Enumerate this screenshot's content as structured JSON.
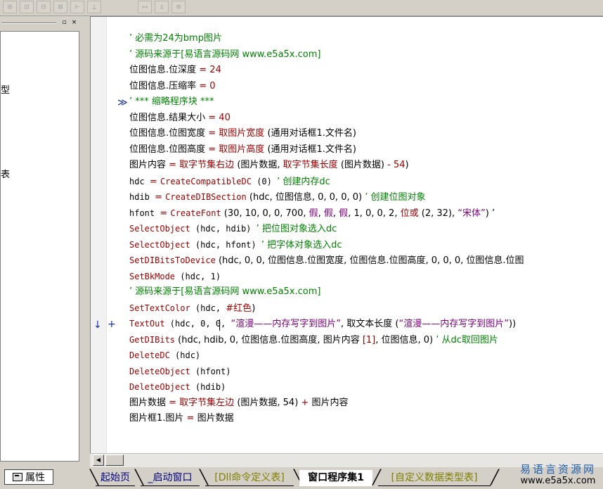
{
  "toolbar": {
    "buttons": [
      {
        "icon": "align-center-icon",
        "glyph": "⊞"
      },
      {
        "icon": "align-top-icon",
        "glyph": "⊡"
      },
      {
        "icon": "align-middle-icon",
        "glyph": "⊟"
      },
      {
        "icon": "align-bottom-icon",
        "glyph": "⊠"
      },
      {
        "icon": "same-width-icon",
        "glyph": "⊢"
      },
      {
        "icon": "same-height-icon",
        "glyph": "⊥"
      },
      {
        "icon": "h-spacing-icon",
        "glyph": "⟷"
      },
      {
        "icon": "v-spacing-icon",
        "glyph": "↕"
      },
      {
        "icon": "center-form-icon",
        "glyph": "⊕"
      }
    ]
  },
  "left_panel": {
    "close_glyph": "×",
    "restore_glyph": "▫",
    "fragments": [
      "型",
      "表"
    ]
  },
  "code": {
    "lines": [
      {
        "indent": 1,
        "parts": [
          {
            "t": "’ 必需为24为bmp图片",
            "c": "c-comment"
          }
        ]
      },
      {
        "indent": 1,
        "parts": [
          {
            "t": "’ 源码来源于[易语言源码网 www.e5a5x.com]",
            "c": "c-comment"
          }
        ]
      },
      {
        "indent": 1,
        "parts": [
          {
            "t": "位图信息.位深度 ",
            "c": "c-black"
          },
          {
            "t": "= ",
            "c": "c-red"
          },
          {
            "t": "24",
            "c": "c-num"
          }
        ]
      },
      {
        "indent": 1,
        "parts": [
          {
            "t": "位图信息.压缩率 ",
            "c": "c-black"
          },
          {
            "t": "= ",
            "c": "c-red"
          },
          {
            "t": "0",
            "c": "c-num"
          }
        ]
      },
      {
        "indent": 1,
        "parts": [
          {
            "t": "’ *** 缩略程序块 ***",
            "c": "c-comment"
          }
        ]
      },
      {
        "indent": 1,
        "parts": [
          {
            "t": "位图信息.结果大小 ",
            "c": "c-black"
          },
          {
            "t": "= ",
            "c": "c-red"
          },
          {
            "t": "40",
            "c": "c-num"
          }
        ]
      },
      {
        "indent": 1,
        "parts": [
          {
            "t": "位图信息.位图宽度 ",
            "c": "c-black"
          },
          {
            "t": "= ",
            "c": "c-red"
          },
          {
            "t": "取图片宽度",
            "c": "c-red"
          },
          {
            "t": " (通用对话框1.文件名)",
            "c": "c-black"
          }
        ]
      },
      {
        "indent": 1,
        "parts": [
          {
            "t": "位图信息.位图高度 ",
            "c": "c-black"
          },
          {
            "t": "= ",
            "c": "c-red"
          },
          {
            "t": "取图片高度",
            "c": "c-red"
          },
          {
            "t": " (通用对话框1.文件名)",
            "c": "c-black"
          }
        ]
      },
      {
        "indent": 1,
        "parts": [
          {
            "t": "图片内容 ",
            "c": "c-black"
          },
          {
            "t": "= ",
            "c": "c-red"
          },
          {
            "t": "取字节集右边",
            "c": "c-red"
          },
          {
            "t": " (图片数据, ",
            "c": "c-black"
          },
          {
            "t": "取字节集长度",
            "c": "c-red"
          },
          {
            "t": " (图片数据) ",
            "c": "c-black"
          },
          {
            "t": "- 54",
            "c": "c-red"
          },
          {
            "t": ")",
            "c": "c-black"
          }
        ]
      },
      {
        "indent": 1,
        "parts": [
          {
            "t": "hdc ",
            "c": "c-black mono"
          },
          {
            "t": "= ",
            "c": "c-red"
          },
          {
            "t": "CreateCompatibleDC",
            "c": "c-red mono"
          },
          {
            "t": " (0) ",
            "c": "c-black mono"
          },
          {
            "t": "’ 创建内存dc",
            "c": "c-comment"
          }
        ]
      },
      {
        "indent": 1,
        "parts": [
          {
            "t": "hdib ",
            "c": "c-black mono"
          },
          {
            "t": "= ",
            "c": "c-red"
          },
          {
            "t": "CreateDIBSection",
            "c": "c-red mono"
          },
          {
            "t": " (hdc, 位图信息, 0, 0, 0, 0) ",
            "c": "c-black"
          },
          {
            "t": "’ 创建位图对象",
            "c": "c-comment"
          }
        ]
      },
      {
        "indent": 1,
        "parts": [
          {
            "t": "hfont ",
            "c": "c-black mono"
          },
          {
            "t": "= ",
            "c": "c-red"
          },
          {
            "t": "CreateFont",
            "c": "c-red mono"
          },
          {
            "t": " (30, 10, 0, 0, 700, ",
            "c": "c-black"
          },
          {
            "t": "假",
            "c": "c-purple"
          },
          {
            "t": ", ",
            "c": "c-black"
          },
          {
            "t": "假",
            "c": "c-purple"
          },
          {
            "t": ", ",
            "c": "c-black"
          },
          {
            "t": "假",
            "c": "c-purple"
          },
          {
            "t": ", 1, 0, 0, 2, ",
            "c": "c-black"
          },
          {
            "t": "位或",
            "c": "c-red"
          },
          {
            "t": " (2, 32), ",
            "c": "c-black"
          },
          {
            "t": "“宋体”",
            "c": "c-purple"
          },
          {
            "t": ")  ’",
            "c": "c-black"
          }
        ]
      },
      {
        "indent": 1,
        "parts": [
          {
            "t": "SelectObject",
            "c": "c-red mono"
          },
          {
            "t": " (hdc, hdib) ",
            "c": "c-black mono"
          },
          {
            "t": "’ 把位图对象选入dc",
            "c": "c-comment"
          }
        ]
      },
      {
        "indent": 1,
        "parts": [
          {
            "t": "SelectObject",
            "c": "c-red mono"
          },
          {
            "t": " (hdc, hfont) ",
            "c": "c-black mono"
          },
          {
            "t": "’ 把字体对象选入dc",
            "c": "c-comment"
          }
        ]
      },
      {
        "indent": 1,
        "parts": [
          {
            "t": "SetDIBitsToDevice",
            "c": "c-red mono"
          },
          {
            "t": " (hdc, 0, 0, 位图信息.位图宽度, 位图信息.位图高度, 0, 0, 0, 位图信息.位图",
            "c": "c-black"
          }
        ]
      },
      {
        "indent": 1,
        "parts": [
          {
            "t": "SetBkMode",
            "c": "c-red mono"
          },
          {
            "t": " (hdc, 1)",
            "c": "c-black mono"
          }
        ]
      },
      {
        "indent": 1,
        "parts": [
          {
            "t": "’ 源码来源于[易语言源码网 www.e5a5x.com]",
            "c": "c-comment"
          }
        ]
      },
      {
        "indent": 1,
        "parts": [
          {
            "t": "SetTextColor",
            "c": "c-red mono"
          },
          {
            "t": " (hdc, ",
            "c": "c-black mono"
          },
          {
            "t": "#红色",
            "c": "c-red"
          },
          {
            "t": ")",
            "c": "c-black"
          }
        ]
      },
      {
        "indent": 1,
        "parts": [
          {
            "t": "TextOut",
            "c": "c-red mono"
          },
          {
            "t": " (hdc, 0, 0, ",
            "c": "c-black mono"
          },
          {
            "t": "“渲漫——内存写字到图片”",
            "c": "c-purple"
          },
          {
            "t": ", 取文本长度 (",
            "c": "c-black"
          },
          {
            "t": "“渲漫——内存写字到图片”",
            "c": "c-purple"
          },
          {
            "t": "))",
            "c": "c-black"
          }
        ]
      },
      {
        "indent": 1,
        "parts": [
          {
            "t": "GetDIBits",
            "c": "c-red mono"
          },
          {
            "t": " (hdc, hdib, 0, 位图信息.位图高度, 图片内容 ",
            "c": "c-black"
          },
          {
            "t": "[1]",
            "c": "c-red"
          },
          {
            "t": ", 位图信息, 0) ",
            "c": "c-black"
          },
          {
            "t": "’ 从dc取回图片",
            "c": "c-comment"
          }
        ]
      },
      {
        "indent": 1,
        "parts": [
          {
            "t": "DeleteDC",
            "c": "c-red mono"
          },
          {
            "t": " (hdc)",
            "c": "c-black mono"
          }
        ]
      },
      {
        "indent": 1,
        "parts": [
          {
            "t": "DeleteObject",
            "c": "c-red mono"
          },
          {
            "t": " (hfont)",
            "c": "c-black mono"
          }
        ]
      },
      {
        "indent": 1,
        "parts": [
          {
            "t": "DeleteObject",
            "c": "c-red mono"
          },
          {
            "t": " (hdib)",
            "c": "c-black mono"
          }
        ]
      },
      {
        "indent": 1,
        "parts": [
          {
            "t": "图片数据 ",
            "c": "c-black"
          },
          {
            "t": "= ",
            "c": "c-red"
          },
          {
            "t": "取字节集左边",
            "c": "c-red"
          },
          {
            "t": " (图片数据, 54) ",
            "c": "c-black"
          },
          {
            "t": "+ ",
            "c": "c-red"
          },
          {
            "t": "图片内容",
            "c": "c-black"
          }
        ]
      },
      {
        "indent": 1,
        "parts": [
          {
            "t": "图片框1.图片 ",
            "c": "c-black"
          },
          {
            "t": "= ",
            "c": "c-red"
          },
          {
            "t": "图片数据",
            "c": "c-black"
          }
        ]
      }
    ],
    "collapsed_marker": "≫",
    "arrow_marker": "↓",
    "plus_marker": "+"
  },
  "scrollbar": {
    "left_arrow": "◀"
  },
  "bottom": {
    "properties_tab": "属性",
    "tabs": [
      {
        "label": "起始页",
        "color": "#000080"
      },
      {
        "label": "_启动窗口",
        "color": "#000080"
      },
      {
        "label": "[Dll命令定义表]",
        "color": "#808000"
      },
      {
        "label": "窗口程序集1",
        "color": "#000000"
      },
      {
        "label": "[自定义数据类型表]",
        "color": "#808000"
      }
    ],
    "watermark_title": "易语言资源网",
    "watermark_url": "www.e5a5x.com"
  }
}
